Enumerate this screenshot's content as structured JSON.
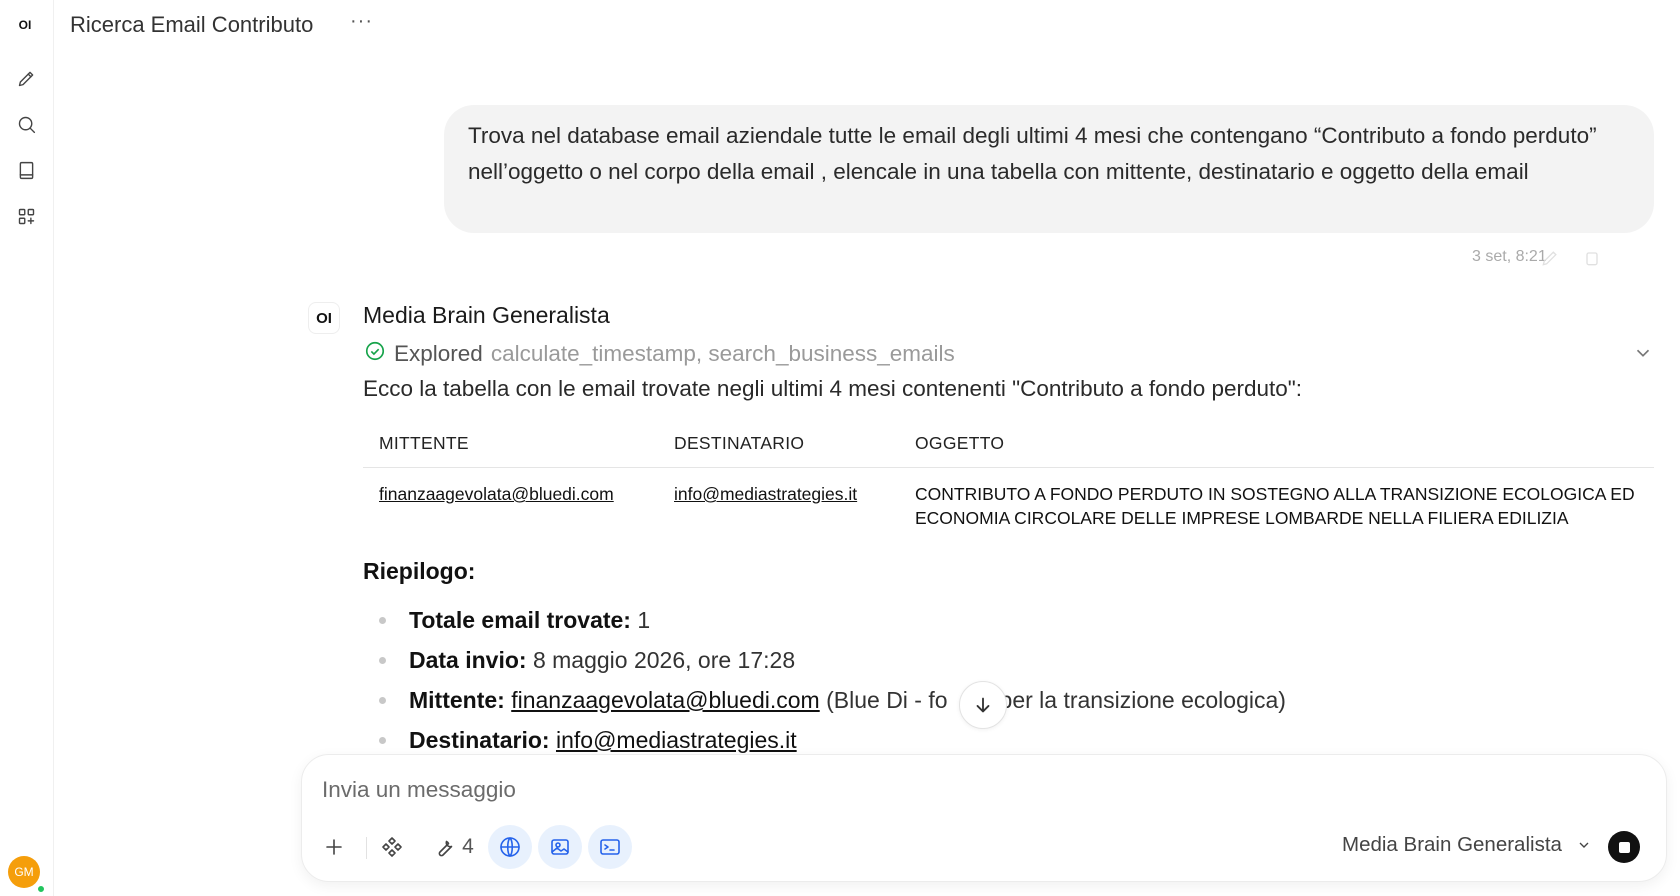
{
  "sidebar": {
    "logo": "OI",
    "user_initials": "GM"
  },
  "header": {
    "title": "Ricerca Email Contributo",
    "menu": "···"
  },
  "user_message": {
    "text": "Trova nel database email aziendale tutte le email degli ultimi 4 mesi che contengano “Contributo a fondo perduto” nell’oggetto o nel corpo della email , elencale in una tabella con mittente, destinatario e oggetto della email",
    "timestamp": "3 set, 8:21"
  },
  "assistant": {
    "avatar": "OI",
    "name": "Media Brain Generalista",
    "explored_label": "Explored",
    "explored_tools": "calculate_timestamp, search_business_emails",
    "intro": "Ecco la tabella con le email trovate negli ultimi 4 mesi contenenti \"Contributo a fondo perduto\":",
    "table": {
      "headers": [
        "MITTENTE",
        "DESTINATARIO",
        "OGGETTO"
      ],
      "rows": [
        {
          "mittente": "finanzaagevolata@bluedi.com",
          "destinatario": "info@mediastrategies.it",
          "oggetto": "CONTRIBUTO A FONDO PERDUTO IN SOSTEGNO ALLA TRANSIZIONE ECOLOGICA ED ECONOMIA CIRCOLARE DELLE IMPRESE LOMBARDE NELLA FILIERA EDILIZIA"
        }
      ]
    },
    "summary_title": "Riepilogo:",
    "summary": {
      "totale_label": "Totale email trovate:",
      "totale_value": "1",
      "data_label": "Data invio:",
      "data_value": "8 maggio 2026, ore 17:28",
      "mittente_label": "Mittente:",
      "mittente_link": "finanzaagevolata@bluedi.com",
      "mittente_note_a": "(Blue Di - fo",
      "mittente_note_b": "per la transizione ecologica)",
      "destinatario_label": "Destinatario:",
      "destinatario_link": "info@mediastrategies.it"
    }
  },
  "composer": {
    "placeholder": "Invia un messaggio",
    "tool_count": "4",
    "model": "Media Brain Generalista",
    "active_color": "#2563eb"
  }
}
